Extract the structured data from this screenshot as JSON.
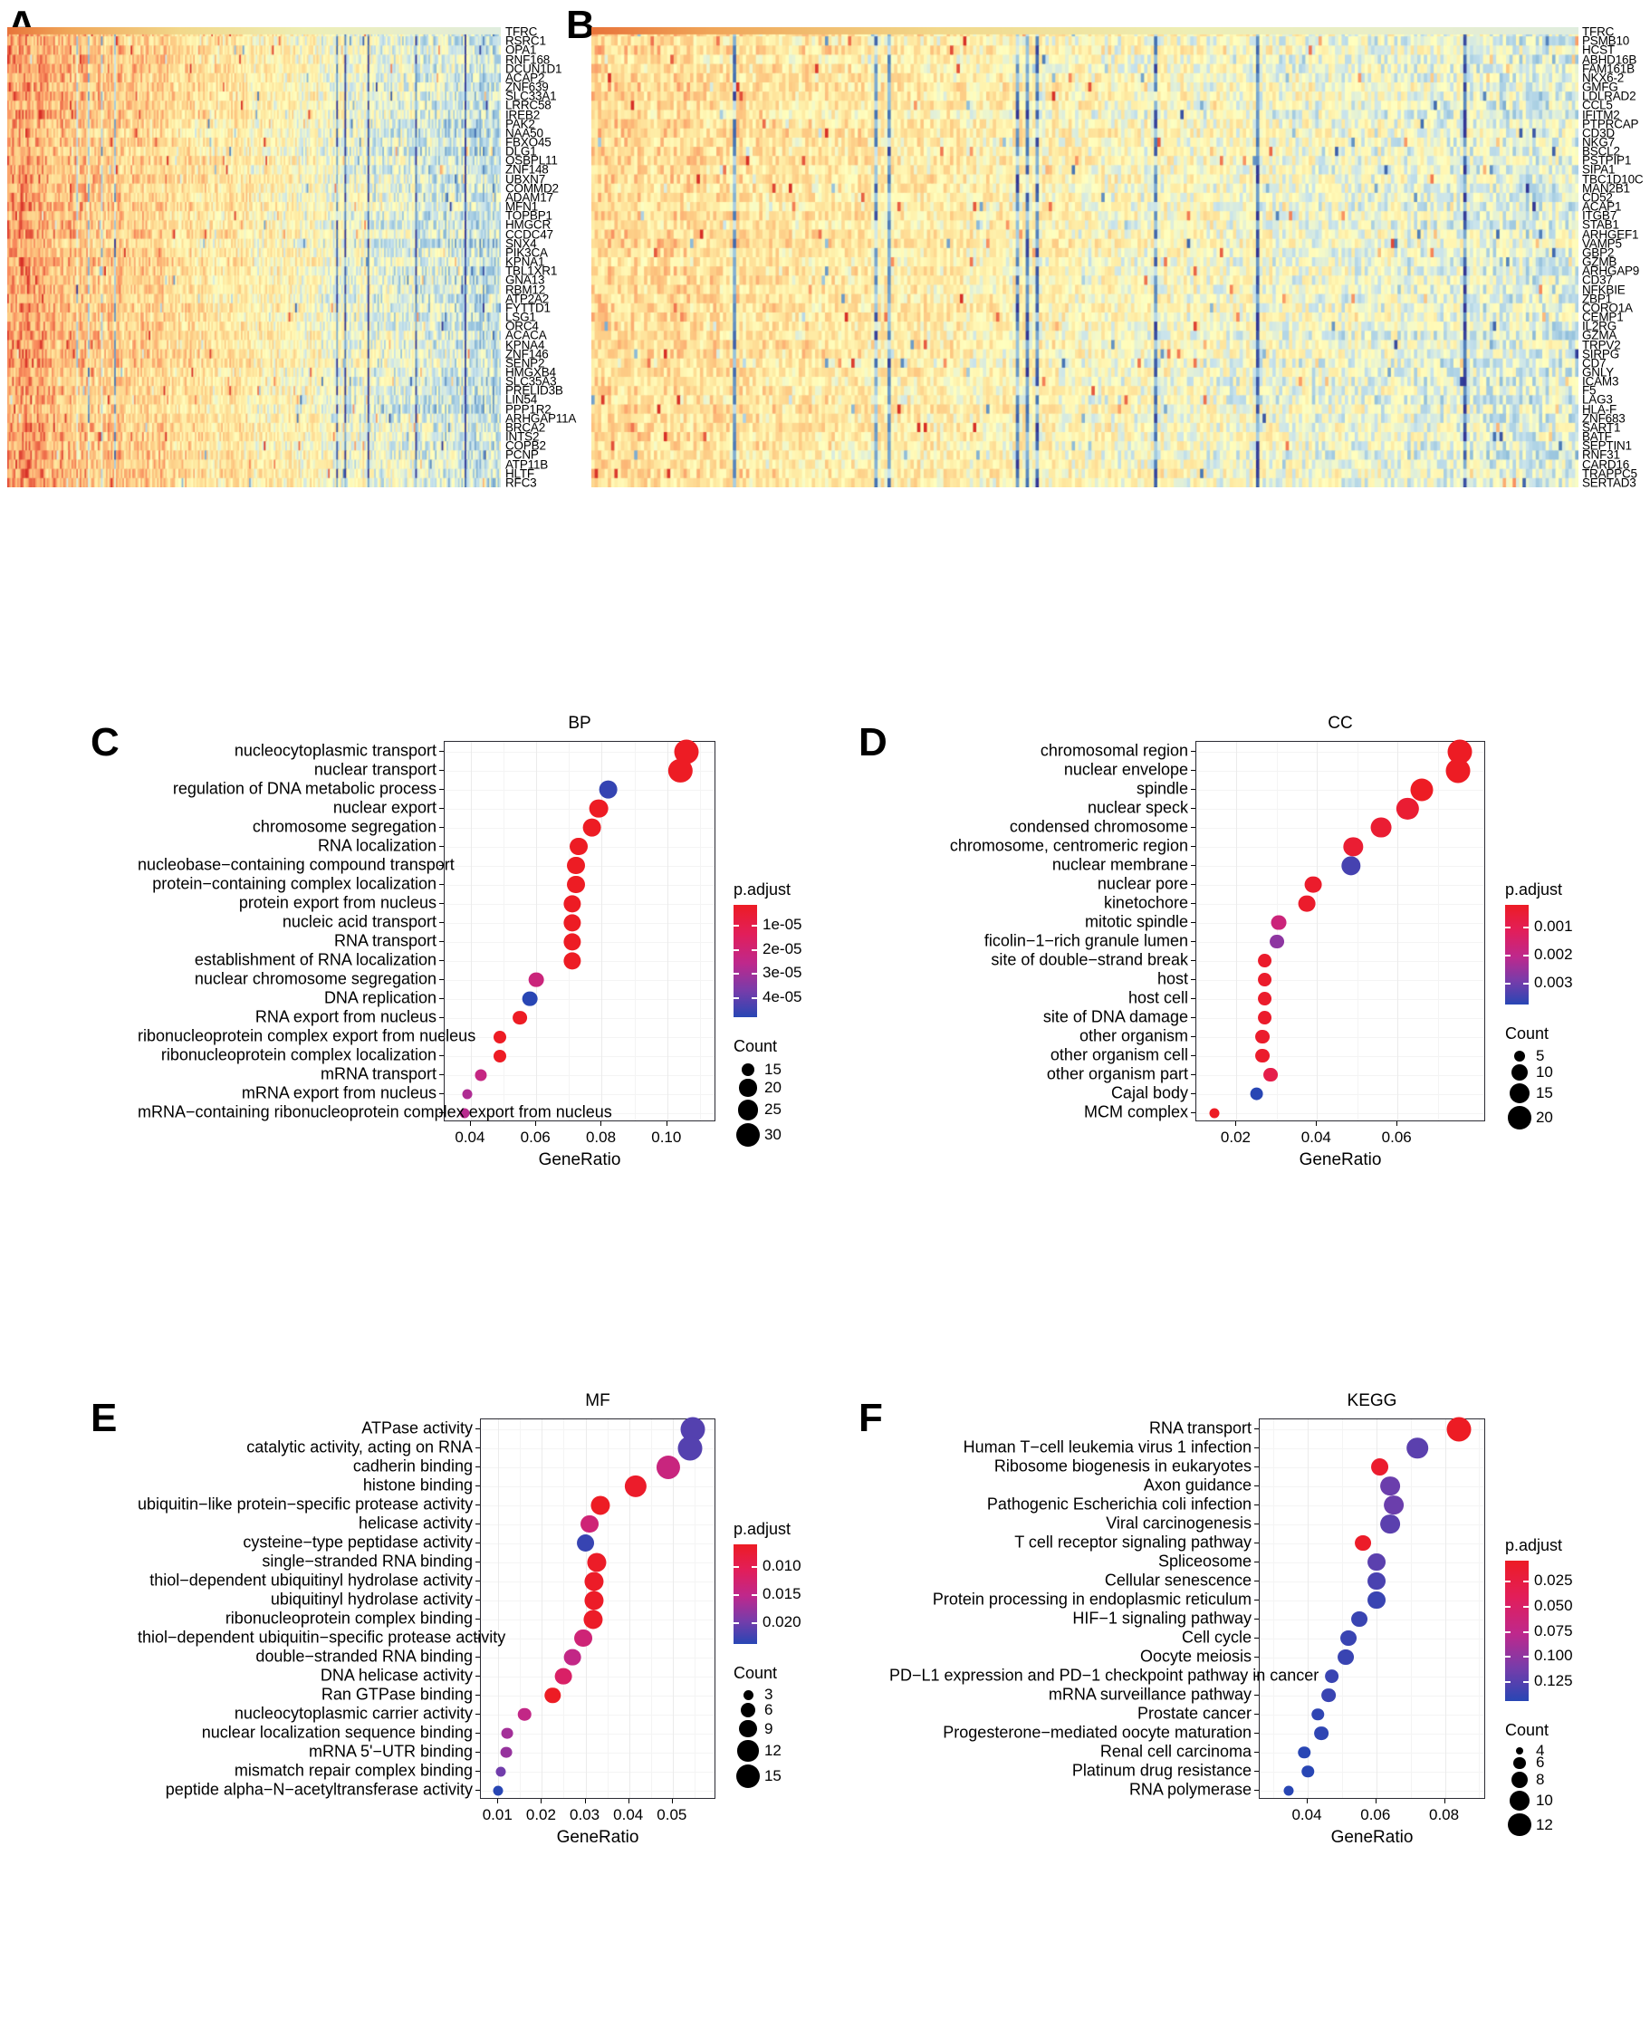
{
  "figure": {
    "panels": [
      "A",
      "B",
      "C",
      "D",
      "E",
      "F"
    ]
  },
  "panelA": {
    "letter": "A",
    "type": "heatmap",
    "genes": [
      "TFRC",
      "RSRC1",
      "OPA1",
      "RNF168",
      "DCUN1D1",
      "ACAP2",
      "ZNF639",
      "SLC33A1",
      "LRRC58",
      "IREB2",
      "PAK2",
      "NAA50",
      "FBXO45",
      "DLG1",
      "OSBPL11",
      "ZNF148",
      "UBXN7",
      "COMMD2",
      "ADAM17",
      "MFN1",
      "TOPBP1",
      "HMGCR",
      "CCDC47",
      "SNX4",
      "PIK3CA",
      "KPNA1",
      "TBL1XR1",
      "GNA13",
      "RBM12",
      "ATP2A2",
      "FYTTD1",
      "LSG1",
      "ORC4",
      "ACACA",
      "KPNA4",
      "ZNF146",
      "SENP2",
      "HMGXB4",
      "SLC35A3",
      "PRELID3B",
      "LIN54",
      "PPP1R2",
      "ARHGAP11A",
      "BRCA2",
      "INTS2",
      "COPB2",
      "PCNP",
      "ATP11B",
      "HLTF",
      "RFC3"
    ]
  },
  "panelB": {
    "letter": "B",
    "type": "heatmap",
    "genes": [
      "TFRC",
      "PSMB10",
      "HCST",
      "ABHD16B",
      "FAM161B",
      "NKX6-2",
      "GMFG",
      "LDLRAD2",
      "CCL5",
      "IFITM2",
      "PTPRCAP",
      "CD3D",
      "NKG7",
      "BSCL2",
      "PSTPIP1",
      "SIPA1",
      "TBC1D10C",
      "MAN2B1",
      "CD52",
      "ACAP1",
      "ITGB7",
      "STAB1",
      "ARHGEF1",
      "VAMP5",
      "GBP2",
      "GZMB",
      "ARHGAP9",
      "CD37",
      "NFKBIE",
      "ZBP1",
      "CORO1A",
      "CEMP1",
      "IL2RG",
      "GZMA",
      "TRPV2",
      "SIRPG",
      "CD7",
      "GNLY",
      "ICAM3",
      "F5",
      "LAG3",
      "HLA-F",
      "ZNF683",
      "SART1",
      "BATF",
      "SEPTIN1",
      "RNF31",
      "CARD16",
      "TRAPPC5",
      "SERTAD3"
    ]
  },
  "panelC": {
    "letter": "C",
    "chart_data": {
      "type": "scatter",
      "title": "BP",
      "xlabel": "GeneRatio",
      "ylabel": "",
      "xlim": [
        0.032,
        0.115
      ],
      "xticks": [
        0.04,
        0.06,
        0.08,
        0.1
      ],
      "xticklabels": [
        "0.04",
        "0.06",
        "0.08",
        "0.10"
      ],
      "grid": true,
      "legend_position": "right",
      "categories": [
        "nucleocytoplasmic transport",
        "nuclear transport",
        "regulation of DNA metabolic process",
        "nuclear export",
        "chromosome segregation",
        "RNA localization",
        "nucleobase−containing compound transport",
        "protein−containing complex localization",
        "protein export from nucleus",
        "nucleic acid transport",
        "RNA transport",
        "establishment of RNA localization",
        "nuclear chromosome segregation",
        "DNA replication",
        "RNA export from nucleus",
        "ribonucleoprotein complex export from nucleus",
        "ribonucleoprotein complex localization",
        "mRNA transport",
        "mRNA export from nucleus",
        "mRNA−containing ribonucleoprotein complex export from nucleus"
      ],
      "x": [
        0.106,
        0.104,
        0.082,
        0.079,
        0.077,
        0.073,
        0.072,
        0.072,
        0.071,
        0.071,
        0.071,
        0.071,
        0.06,
        0.058,
        0.055,
        0.049,
        0.049,
        0.043,
        0.039,
        0.038
      ],
      "count": [
        31,
        30,
        22,
        22,
        22,
        21,
        21,
        21,
        20,
        20,
        20,
        20,
        17,
        17,
        16,
        14,
        14,
        13,
        11,
        11
      ],
      "padjust": [
        1e-05,
        1e-05,
        3.9e-05,
        1e-05,
        1e-05,
        1e-05,
        1e-05,
        1e-05,
        1e-05,
        1e-05,
        1e-05,
        1e-05,
        2.4e-05,
        4e-05,
        1e-05,
        1e-05,
        1e-05,
        2.5e-05,
        2.8e-05,
        2.7e-05
      ]
    },
    "legend": {
      "padjust_title": "p.adjust",
      "padjust_ticks": [
        "1e-05",
        "2e-05",
        "3e-05",
        "4e-05"
      ],
      "count_title": "Count",
      "count_ticks": [
        "15",
        "20",
        "25",
        "30"
      ]
    }
  },
  "panelD": {
    "letter": "D",
    "chart_data": {
      "type": "scatter",
      "title": "CC",
      "xlabel": "GeneRatio",
      "ylabel": "",
      "xlim": [
        0.01,
        0.082
      ],
      "xticks": [
        0.02,
        0.04,
        0.06
      ],
      "xticklabels": [
        "0.02",
        "0.04",
        "0.06"
      ],
      "grid": true,
      "legend_position": "right",
      "categories": [
        "chromosomal region",
        "nuclear envelope",
        "spindle",
        "nuclear speck",
        "condensed chromosome",
        "chromosome, centromeric region",
        "nuclear membrane",
        "nuclear pore",
        "kinetochore",
        "mitotic spindle",
        "ficolin−1−rich granule lumen",
        "site of double−strand break",
        "host",
        "host cell",
        "site of DNA damage",
        "other organism",
        "other organism cell",
        "other organism part",
        "Cajal body",
        "MCM complex"
      ],
      "x": [
        0.0755,
        0.075,
        0.066,
        0.0625,
        0.056,
        0.049,
        0.0485,
        0.039,
        0.0375,
        0.0305,
        0.03,
        0.027,
        0.027,
        0.027,
        0.027,
        0.0265,
        0.0265,
        0.0285,
        0.025,
        0.0145
      ],
      "count": [
        22,
        22,
        19,
        18,
        16,
        14,
        14,
        11,
        11,
        9,
        8,
        8,
        8,
        8,
        8,
        8,
        8,
        8,
        7,
        4
      ],
      "padjust": [
        0.0009,
        0.0009,
        0.0009,
        0.0011,
        0.0011,
        0.0011,
        0.0031,
        0.001,
        0.001,
        0.002,
        0.0026,
        0.001,
        0.001,
        0.001,
        0.001,
        0.001,
        0.001,
        0.0014,
        0.0033,
        0.0009
      ]
    },
    "legend": {
      "padjust_title": "p.adjust",
      "padjust_ticks": [
        "0.001",
        "0.002",
        "0.003"
      ],
      "count_title": "Count",
      "count_ticks": [
        "5",
        "10",
        "15",
        "20"
      ]
    }
  },
  "panelE": {
    "letter": "E",
    "chart_data": {
      "type": "scatter",
      "title": "MF",
      "xlabel": "GeneRatio",
      "ylabel": "",
      "xlim": [
        0.006,
        0.06
      ],
      "xticks": [
        0.01,
        0.02,
        0.03,
        0.04,
        0.05
      ],
      "xticklabels": [
        "0.01",
        "0.02",
        "0.03",
        "0.04",
        "0.05"
      ],
      "grid": true,
      "legend_position": "right",
      "categories": [
        "ATPase activity",
        "catalytic activity, acting on RNA",
        "cadherin binding",
        "histone binding",
        "ubiquitin−like protein−specific protease activity",
        "helicase activity",
        "cysteine−type peptidase activity",
        "single−stranded RNA binding",
        "thiol−dependent ubiquitinyl hydrolase activity",
        "ubiquitinyl hydrolase activity",
        "ribonucleoprotein complex binding",
        "thiol−dependent ubiquitin−specific protease activity",
        "double−stranded RNA binding",
        "DNA helicase activity",
        "Ran GTPase binding",
        "nucleocytoplasmic carrier activity",
        "nuclear localization sequence binding",
        "mRNA 5'−UTR binding",
        "mismatch repair complex binding",
        "peptide alpha−N−acetyltransferase activity"
      ],
      "x": [
        0.0545,
        0.054,
        0.049,
        0.0415,
        0.0335,
        0.031,
        0.03,
        0.0325,
        0.032,
        0.032,
        0.0318,
        0.0295,
        0.027,
        0.025,
        0.0225,
        0.016,
        0.012,
        0.0118,
        0.0105,
        0.01
      ],
      "count": [
        16,
        16,
        15,
        13,
        10,
        9,
        9,
        10,
        10,
        10,
        10,
        9,
        8,
        8,
        7,
        5,
        4,
        4,
        3,
        3
      ],
      "padjust": [
        0.0205,
        0.0205,
        0.0155,
        0.01,
        0.0095,
        0.015,
        0.0215,
        0.0098,
        0.0098,
        0.0098,
        0.0098,
        0.015,
        0.016,
        0.014,
        0.0095,
        0.016,
        0.0175,
        0.018,
        0.0195,
        0.022
      ]
    },
    "legend": {
      "padjust_title": "p.adjust",
      "padjust_ticks": [
        "0.010",
        "0.015",
        "0.020"
      ],
      "count_title": "Count",
      "count_ticks": [
        "3",
        "6",
        "9",
        "12",
        "15"
      ]
    }
  },
  "panelF": {
    "letter": "F",
    "chart_data": {
      "type": "scatter",
      "title": "KEGG",
      "xlabel": "GeneRatio",
      "ylabel": "",
      "xlim": [
        0.026,
        0.092
      ],
      "xticks": [
        0.04,
        0.06,
        0.08
      ],
      "xticklabels": [
        "0.04",
        "0.06",
        "0.08"
      ],
      "grid": true,
      "legend_position": "right",
      "categories": [
        "RNA transport",
        "Human T−cell leukemia virus 1 infection",
        "Ribosome biogenesis in eukaryotes",
        "Axon guidance",
        "Pathogenic Escherichia coli infection",
        "Viral carcinogenesis",
        "T cell receptor signaling pathway",
        "Spliceosome",
        "Cellular senescence",
        "Protein processing in endoplasmic reticulum",
        "HIF−1 signaling pathway",
        "Cell cycle",
        "Oocyte meiosis",
        "PD−L1 expression and PD−1 checkpoint pathway in cancer",
        "mRNA surveillance pathway",
        "Prostate cancer",
        "Progesterone−mediated oocyte maturation",
        "Renal cell carcinoma",
        "Platinum drug resistance",
        "RNA polymerase"
      ],
      "x": [
        0.084,
        0.072,
        0.061,
        0.064,
        0.065,
        0.064,
        0.056,
        0.06,
        0.06,
        0.06,
        0.055,
        0.052,
        0.051,
        0.047,
        0.046,
        0.043,
        0.044,
        0.039,
        0.04,
        0.0345
      ],
      "count": [
        13,
        11,
        9,
        10,
        10,
        10,
        8,
        9,
        9,
        9,
        8,
        8,
        8,
        7,
        7,
        6,
        7,
        6,
        6,
        5
      ],
      "padjust": [
        0.022,
        0.115,
        0.028,
        0.11,
        0.11,
        0.115,
        0.025,
        0.115,
        0.12,
        0.125,
        0.125,
        0.125,
        0.125,
        0.125,
        0.125,
        0.128,
        0.128,
        0.13,
        0.13,
        0.13
      ]
    },
    "legend": {
      "padjust_title": "p.adjust",
      "padjust_ticks": [
        "0.025",
        "0.050",
        "0.075",
        "0.100",
        "0.125"
      ],
      "count_title": "Count",
      "count_ticks": [
        "4",
        "6",
        "8",
        "10",
        "12"
      ]
    }
  }
}
